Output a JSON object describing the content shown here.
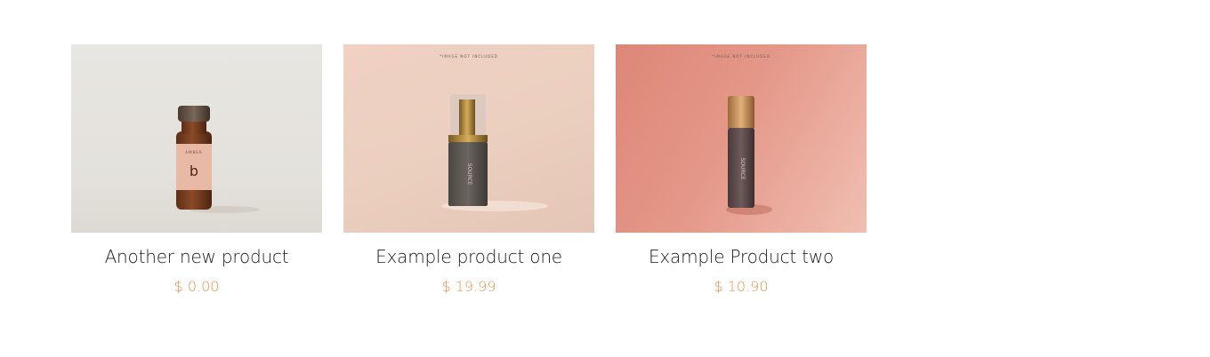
{
  "products": [
    {
      "title": "Another new product",
      "price": "$ 0.00",
      "image": "amber-vial-bottle",
      "image_text": "AMBER"
    },
    {
      "title": "Example product one",
      "price": "$ 19.99",
      "image": "pump-serum-bottle",
      "image_text": "*IMAGE NOT INCLUDED"
    },
    {
      "title": "Example Product two",
      "price": "$ 10.90",
      "image": "roller-bottle",
      "image_text": "*IMAGE NOT INCLUDED"
    }
  ],
  "colors": {
    "price": "#e8954f",
    "title": "#1a1a1a"
  }
}
